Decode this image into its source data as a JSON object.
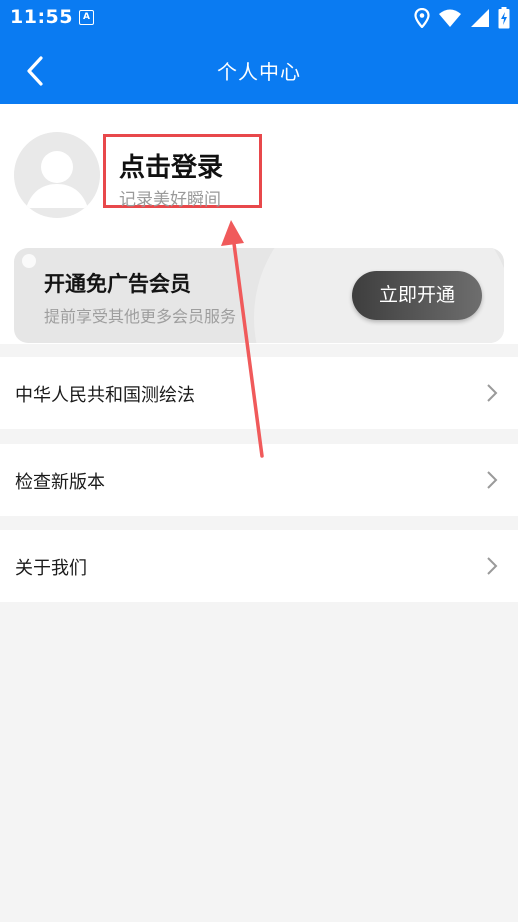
{
  "status_bar": {
    "time": "11:55",
    "notification_icon": "A",
    "icons": [
      "location-icon",
      "wifi-icon",
      "signal-icon",
      "battery-charging-icon"
    ]
  },
  "app_bar": {
    "title": "个人中心",
    "back_icon": "chevron-left-icon",
    "background": "#0a7bf2"
  },
  "profile": {
    "login_title": "点击登录",
    "login_subtitle": "记录美好瞬间",
    "avatar_icon": "default-avatar-icon",
    "highlight_color": "#e8484b"
  },
  "vip": {
    "title": "开通免广告会员",
    "subtitle": "提前享受其他更多会员服务",
    "button_label": "立即开通"
  },
  "menu": {
    "items": [
      {
        "label": "中华人民共和国测绘法"
      },
      {
        "label": "检查新版本"
      },
      {
        "label": "关于我们"
      }
    ]
  },
  "annotation": {
    "arrow_color": "#f05a5b"
  }
}
